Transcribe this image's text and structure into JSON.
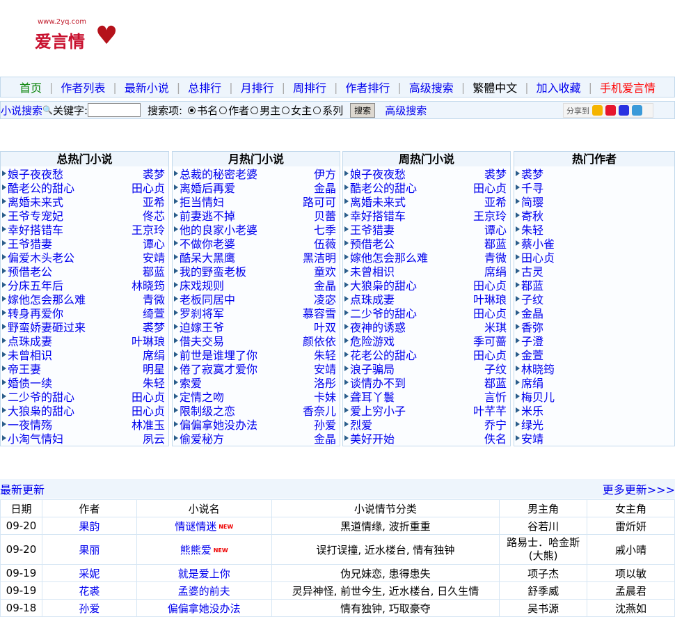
{
  "logo": {
    "url": "www.2yq.com",
    "name": "爱言情"
  },
  "nav": [
    {
      "label": "首页",
      "color": "#008000"
    },
    {
      "label": "作者列表"
    },
    {
      "label": "最新小说"
    },
    {
      "label": "总排行"
    },
    {
      "label": "月排行"
    },
    {
      "label": "周排行"
    },
    {
      "label": "作者排行"
    },
    {
      "label": "高级搜索"
    },
    {
      "label": "繁體中文",
      "color": "#000000"
    },
    {
      "label": "加入收藏"
    },
    {
      "label": "手机爱言情",
      "color": "#ff0000"
    }
  ],
  "search": {
    "title": "小说搜索",
    "keyword_label": "关键字:",
    "keyword_value": "",
    "field_label": "搜索项:",
    "options": [
      "书名",
      "作者",
      "男主",
      "女主",
      "系列"
    ],
    "selected": 0,
    "button": "搜索",
    "advanced": "高级搜索",
    "share": "分享到"
  },
  "lists": [
    {
      "title": "总热门小说",
      "items": [
        [
          "娘子夜夜愁",
          "裘梦"
        ],
        [
          "酷老公的甜心",
          "田心贞"
        ],
        [
          "离婚未来式",
          "亚希"
        ],
        [
          "王爷专宠妃",
          "佟芯"
        ],
        [
          "幸好搭错车",
          "王京玲"
        ],
        [
          "王爷猎妻",
          "谭心"
        ],
        [
          "偏爱木头老公",
          "安靖"
        ],
        [
          "预借老公",
          "鄀蓝"
        ],
        [
          "分床五年后",
          "林晓筠"
        ],
        [
          "嫁他怎会那么难",
          "青微"
        ],
        [
          "转身再爱你",
          "绮萱"
        ],
        [
          "野蛮娇妻砸过来",
          "裘梦"
        ],
        [
          "点珠成妻",
          "叶琳琅"
        ],
        [
          "未曾相识",
          "席绢"
        ],
        [
          "帝王妻",
          "明星"
        ],
        [
          "婚债一续",
          "朱轻"
        ],
        [
          "二少爷的甜心",
          "田心贞"
        ],
        [
          "大狼枭的甜心",
          "田心贞"
        ],
        [
          "一夜情殇",
          "林准玉"
        ],
        [
          "小淘气情妇",
          "夙云"
        ]
      ]
    },
    {
      "title": "月热门小说",
      "items": [
        [
          "总裁的秘密老婆",
          "伊方"
        ],
        [
          "离婚后再爱",
          "金晶"
        ],
        [
          "拒当情妇",
          "路可可"
        ],
        [
          "前妻逃不掉",
          "贝蕾"
        ],
        [
          "他的良家小老婆",
          "七季"
        ],
        [
          "不做你老婆",
          "伍薇"
        ],
        [
          "酷呆大黑鹰",
          "黑洁明"
        ],
        [
          "我的野蛮老板",
          "童欢"
        ],
        [
          "床戏规则",
          "金晶"
        ],
        [
          "老板同居中",
          "凌宓"
        ],
        [
          "罗刹将军",
          "慕容雪"
        ],
        [
          "迫嫁王爷",
          "叶双"
        ],
        [
          "借夫交易",
          "颜依依"
        ],
        [
          "前世是谁埋了你",
          "朱轻"
        ],
        [
          "倦了寂寞才爱你",
          "安靖"
        ],
        [
          "索爱",
          "洛彤"
        ],
        [
          "定情之吻",
          "卡妹"
        ],
        [
          "限制级之恋",
          "香奈儿"
        ],
        [
          "偏偏拿她没办法",
          "孙爱"
        ],
        [
          "偷爱秘方",
          "金晶"
        ]
      ]
    },
    {
      "title": "周热门小说",
      "items": [
        [
          "娘子夜夜愁",
          "裘梦"
        ],
        [
          "酷老公的甜心",
          "田心贞"
        ],
        [
          "离婚未来式",
          "亚希"
        ],
        [
          "幸好搭错车",
          "王京玲"
        ],
        [
          "王爷猎妻",
          "谭心"
        ],
        [
          "预借老公",
          "鄀蓝"
        ],
        [
          "嫁他怎会那么难",
          "青微"
        ],
        [
          "未曾相识",
          "席绢"
        ],
        [
          "大狼枭的甜心",
          "田心贞"
        ],
        [
          "点珠成妻",
          "叶琳琅"
        ],
        [
          "二少爷的甜心",
          "田心贞"
        ],
        [
          "夜神的诱惑",
          "米琪"
        ],
        [
          "危险游戏",
          "季可蔷"
        ],
        [
          "花老公的甜心",
          "田心贞"
        ],
        [
          "浪子骗局",
          "子纹"
        ],
        [
          "谈情办不到",
          "鄀蓝"
        ],
        [
          "聋耳丫鬟",
          "言忻"
        ],
        [
          "爱上穷小子",
          "叶芊芊"
        ],
        [
          "烈爱",
          "乔宁"
        ],
        [
          "美好开始",
          "佚名"
        ]
      ]
    },
    {
      "title": "热门作者",
      "items": [
        [
          "裘梦"
        ],
        [
          "千寻"
        ],
        [
          "简璎"
        ],
        [
          "寄秋"
        ],
        [
          "朱轻"
        ],
        [
          "蔡小雀"
        ],
        [
          "田心贞"
        ],
        [
          "古灵"
        ],
        [
          "鄀蓝"
        ],
        [
          "子纹"
        ],
        [
          "金晶"
        ],
        [
          "香弥"
        ],
        [
          "子澄"
        ],
        [
          "金萱"
        ],
        [
          "林晓筠"
        ],
        [
          "席绢"
        ],
        [
          "梅贝儿"
        ],
        [
          "米乐"
        ],
        [
          "绿光"
        ],
        [
          "安靖"
        ]
      ]
    }
  ],
  "updates": {
    "title": "最新更新",
    "more": "更多更新>>>",
    "headers": [
      "日期",
      "作者",
      "小说名",
      "小说情节分类",
      "男主角",
      "女主角"
    ],
    "new_badge": "NEW",
    "rows": [
      [
        "09-20",
        "果韵",
        "情谜情迷",
        "黑道情缘, 波折重重",
        "谷若川",
        "雷炘妍",
        true
      ],
      [
        "09-20",
        "果丽",
        "熊熊爱",
        "误打误撞, 近水楼台, 情有独钟",
        "路易士．哈金斯(大熊)",
        "戚小晴",
        true
      ],
      [
        "09-19",
        "采妮",
        "就是爱上你",
        "伪兄妹恋, 患得患失",
        "项子杰",
        "项以敏",
        false
      ],
      [
        "09-19",
        "花裘",
        "孟婆的前夫",
        "灵异神怪, 前世今生, 近水楼台, 日久生情",
        "舒季威",
        "孟晨君",
        false
      ],
      [
        "09-18",
        "孙爱",
        "偏偏拿她没办法",
        "情有独钟, 巧取豪夺",
        "吴书源",
        "沈燕如",
        false
      ]
    ]
  }
}
